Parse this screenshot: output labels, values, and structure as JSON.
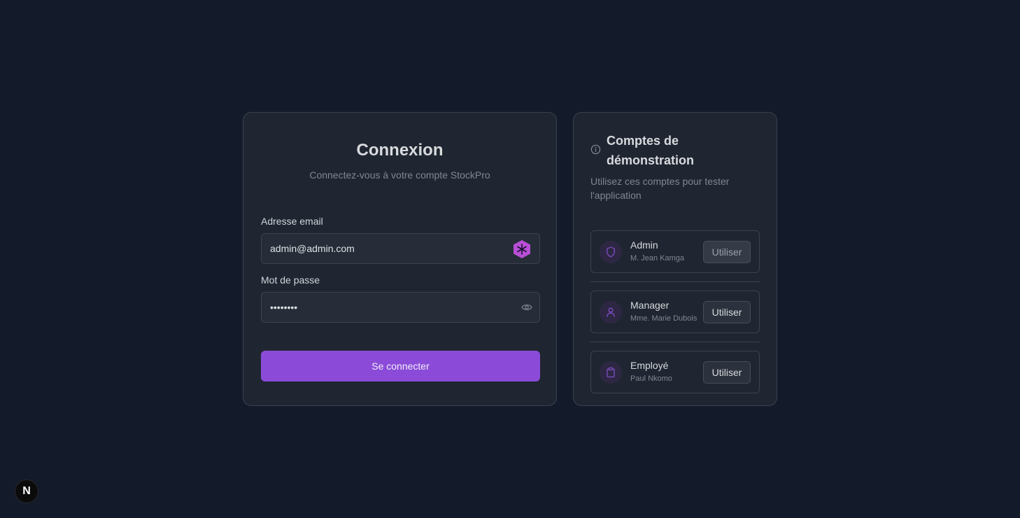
{
  "login": {
    "title": "Connexion",
    "subtitle": "Connectez-vous à votre compte StockPro",
    "email_label": "Adresse email",
    "email_value": "admin@admin.com",
    "password_label": "Mot de passe",
    "password_value": "password",
    "submit_label": "Se connecter"
  },
  "demo": {
    "title": "Comptes de démonstration",
    "description": "Utilisez ces comptes pour tester l'application",
    "accounts": [
      {
        "role": "Admin",
        "user": "M. Jean Kamga",
        "button": "Utiliser",
        "icon": "shield-icon"
      },
      {
        "role": "Manager",
        "user": "Mme. Marie Dubois",
        "button": "Utiliser",
        "icon": "user-icon"
      },
      {
        "role": "Employé",
        "user": "Paul Nkomo",
        "button": "Utiliser",
        "icon": "clipboard-icon"
      }
    ]
  },
  "badge": {
    "letter": "N"
  },
  "colors": {
    "background": "#131a2a",
    "card": "#1f2631",
    "accent": "#8b4bd8"
  }
}
